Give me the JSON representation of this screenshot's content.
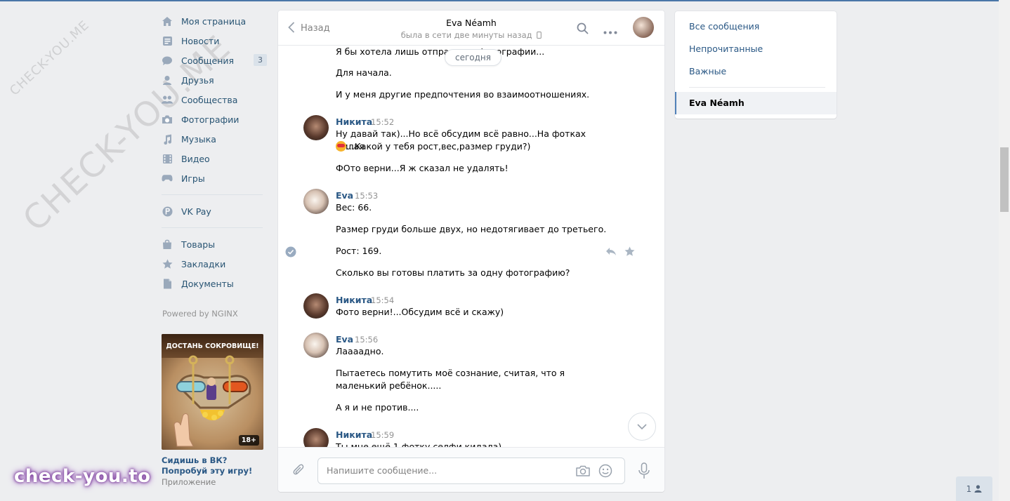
{
  "left_menu": {
    "items": [
      {
        "label": "Моя страница",
        "icon": "home-icon"
      },
      {
        "label": "Новости",
        "icon": "news-icon"
      },
      {
        "label": "Сообщения",
        "icon": "messages-icon",
        "badge": "3"
      },
      {
        "label": "Друзья",
        "icon": "friends-icon"
      },
      {
        "label": "Сообщества",
        "icon": "groups-icon"
      },
      {
        "label": "Фотографии",
        "icon": "camera-icon"
      },
      {
        "label": "Музыка",
        "icon": "music-icon"
      },
      {
        "label": "Видео",
        "icon": "video-icon"
      },
      {
        "label": "Игры",
        "icon": "gamepad-icon"
      }
    ],
    "vkpay": {
      "label": "VK Pay",
      "icon": "vkpay-icon"
    },
    "extra": [
      {
        "label": "Товары",
        "icon": "bag-icon"
      },
      {
        "label": "Закладки",
        "icon": "star-icon"
      },
      {
        "label": "Документы",
        "icon": "document-icon"
      }
    ],
    "powered": "Powered by NGINX",
    "ad": {
      "image_title": "ДОСТАНЬ СОКРОВИЩЕ!",
      "age": "18+",
      "caption": "Сидишь в ВК? Попробуй эту игру!",
      "sub": "Приложение"
    }
  },
  "watermarks": {
    "small": "CHECK-YOU.ME",
    "large": "CHECK-YOU.ME",
    "bottom": "check-you.to"
  },
  "chat": {
    "back_label": "Назад",
    "peer_name": "Eva Néamh",
    "peer_status": "была в сети две минуты назад",
    "date_pill": "сегодня",
    "messages": {
      "m0": "Я бы хотела лишь отправлять фотографии...",
      "m1": "Для начала.",
      "m2": "И у меня другие предпочтения во взаимоотношениях.",
      "g1_author": "Никита",
      "g1_time": "15:52",
      "m3a": "Ну давай так)...Но всё обсудим всё равно...На фотках милая",
      "m3b": "...Какой у тебя рост,вес,размер груди?)",
      "m4": "ФОто верни...Я ж сказал не удалять!",
      "g2_author": "Eva",
      "g2_time": "15:53",
      "m5": "Вес: 66.",
      "m6": "Размер груди больше двух, но недотягивает до третьего.",
      "m7": "Рост: 169.",
      "m8": "Сколько вы готовы платить за одну фотографию?",
      "g3_author": "Никита",
      "g3_time": "15:54",
      "m9": "Фото верни!...Обсудим всё и скажу)",
      "g4_author": "Eva",
      "g4_time": "15:56",
      "m10": "Лаааадно.",
      "m11": "Пытаетесь помутить моё сознание, считая, что я маленький ребёнок.....",
      "m12": "А я и не против....",
      "g5_author": "Никита",
      "g5_time": "15:59",
      "m13": "Ты мне ещё 1 фотку селфи кидала)"
    },
    "composer": {
      "placeholder": "Напишите сообщение..."
    }
  },
  "filters": {
    "all": "Все сообщения",
    "unread": "Непрочитанные",
    "important": "Важные",
    "active": "Eva Néamh"
  },
  "people_count": "1",
  "colors": {
    "accent": "#4a76a8",
    "link": "#2a5885",
    "background": "#edeef0"
  }
}
